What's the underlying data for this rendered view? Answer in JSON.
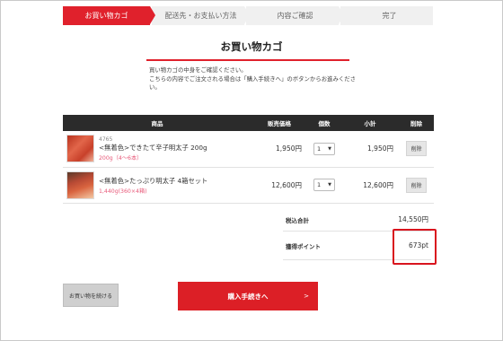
{
  "steps": [
    {
      "label": "お買い物カゴ"
    },
    {
      "label": "配送先・お支払い方法"
    },
    {
      "label": "内容ご確認"
    },
    {
      "label": "完了"
    }
  ],
  "page": {
    "title": "お買い物カゴ",
    "intro_line1": "買い物カゴの中身をご確認ください。",
    "intro_line2": "こちらの内容でご注文される場合は「購入手続きへ」のボタンからお進みください。"
  },
  "table": {
    "headers": {
      "product": "商品",
      "price": "販売価格",
      "qty": "個数",
      "subtotal": "小計",
      "delete": "削除"
    },
    "rows": [
      {
        "code": "4765",
        "name": "<無着色>できたて辛子明太子 200g",
        "sub": "200g（4～6本）",
        "price": "1,950円",
        "qty": "1",
        "subtotal": "1,950円",
        "delete_label": "削除"
      },
      {
        "code": "",
        "name": "<無着色>たっぷり明太子 4箱セット",
        "sub": "1,440g(360×4箱)",
        "price": "12,600円",
        "qty": "1",
        "subtotal": "12,600円",
        "delete_label": "削除"
      }
    ]
  },
  "summary": {
    "total_label": "税込合計",
    "total_value": "14,550円",
    "points_label": "獲得ポイント",
    "points_value": "673pt"
  },
  "buttons": {
    "continue_label": "お買い物を続ける",
    "checkout_label": "購入手続きへ",
    "checkout_chevron": ">"
  },
  "colors": {
    "accent": "#e0212c",
    "header_bg": "#2b2b2b",
    "highlight": "#d9141e"
  }
}
